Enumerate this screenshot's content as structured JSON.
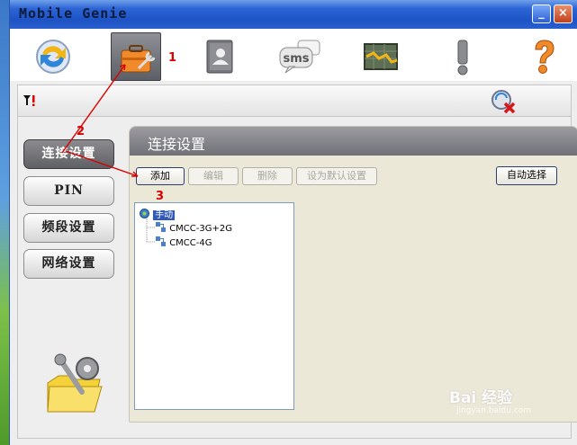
{
  "window": {
    "title": "Mobile Genie",
    "minimize": "_",
    "close": "×"
  },
  "toolbar": {
    "items": [
      {
        "name": "sync",
        "icon": "sync-icon"
      },
      {
        "name": "settings",
        "icon": "toolbox-icon",
        "active": true
      },
      {
        "name": "contacts",
        "icon": "contacts-icon"
      },
      {
        "name": "sms",
        "icon": "sms-icon",
        "label": "sms"
      },
      {
        "name": "statistics",
        "icon": "chart-icon"
      },
      {
        "name": "alerts",
        "icon": "exclamation-icon"
      },
      {
        "name": "help",
        "icon": "question-icon"
      }
    ]
  },
  "sidebar": {
    "items": [
      {
        "label": "连接设置",
        "active": true
      },
      {
        "label": "PIN"
      },
      {
        "label": "频段设置"
      },
      {
        "label": "网络设置"
      }
    ]
  },
  "panel": {
    "title": "连接设置",
    "buttons": {
      "add": "添加",
      "edit": "编辑",
      "delete": "删除",
      "set_default": "设为默认设置",
      "auto_select": "自动选择"
    },
    "tree": {
      "root": "手动",
      "children": [
        "CMCC-3G+2G",
        "CMCC-4G"
      ]
    }
  },
  "annotations": [
    "1",
    "2",
    "3"
  ],
  "watermark": {
    "text": "Bai 经验",
    "sub": "jingyan.baidu.com"
  },
  "colors": {
    "annotation": "#d80000",
    "title_bar": "#2c64d6",
    "panel_header": "#808086"
  }
}
